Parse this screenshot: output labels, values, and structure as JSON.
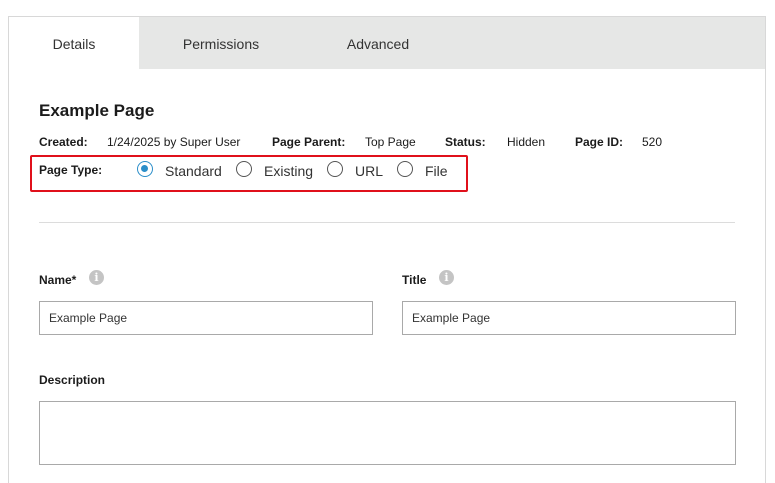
{
  "tabs": {
    "details": "Details",
    "permissions": "Permissions",
    "advanced": "Advanced"
  },
  "page": {
    "title": "Example Page"
  },
  "meta": {
    "created_label": "Created:",
    "created_value": "1/24/2025 by Super User",
    "parent_label": "Page Parent:",
    "parent_value": "Top Page",
    "status_label": "Status:",
    "status_value": "Hidden",
    "id_label": "Page ID:",
    "id_value": "520"
  },
  "page_type": {
    "label": "Page Type:",
    "options": [
      "Standard",
      "Existing",
      "URL",
      "File"
    ],
    "selected": "Standard"
  },
  "form": {
    "name_label": "Name*",
    "name_value": "Example Page",
    "title_label": "Title",
    "title_value": "Example Page",
    "description_label": "Description",
    "description_value": ""
  },
  "colors": {
    "accent": "#2b8ec9",
    "highlight": "#e0101b",
    "tabbar": "#e6e7e6"
  }
}
